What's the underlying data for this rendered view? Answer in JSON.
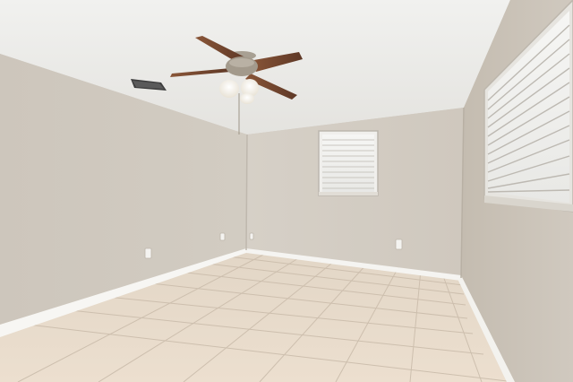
{
  "scene": {
    "type": "photo",
    "subject": "empty-room",
    "elements": [
      "ceiling-fan",
      "ceiling-vent",
      "back-window-with-blinds",
      "side-window-with-blinds",
      "electrical-outlets",
      "tile-floor",
      "baseboards"
    ]
  },
  "colors": {
    "ceiling": "#eeeeec",
    "wall_left": "#cfc9bf",
    "wall_back": "#d3ccc3",
    "wall_right": "#c9c1b6",
    "floor": "#e6d9c8",
    "grout": "#cdbfae",
    "baseboard": "#f7f6f3",
    "fan_blade": "#7a4a32",
    "fan_metal": "#a39a8c",
    "window_light": "#f3f3f1"
  }
}
